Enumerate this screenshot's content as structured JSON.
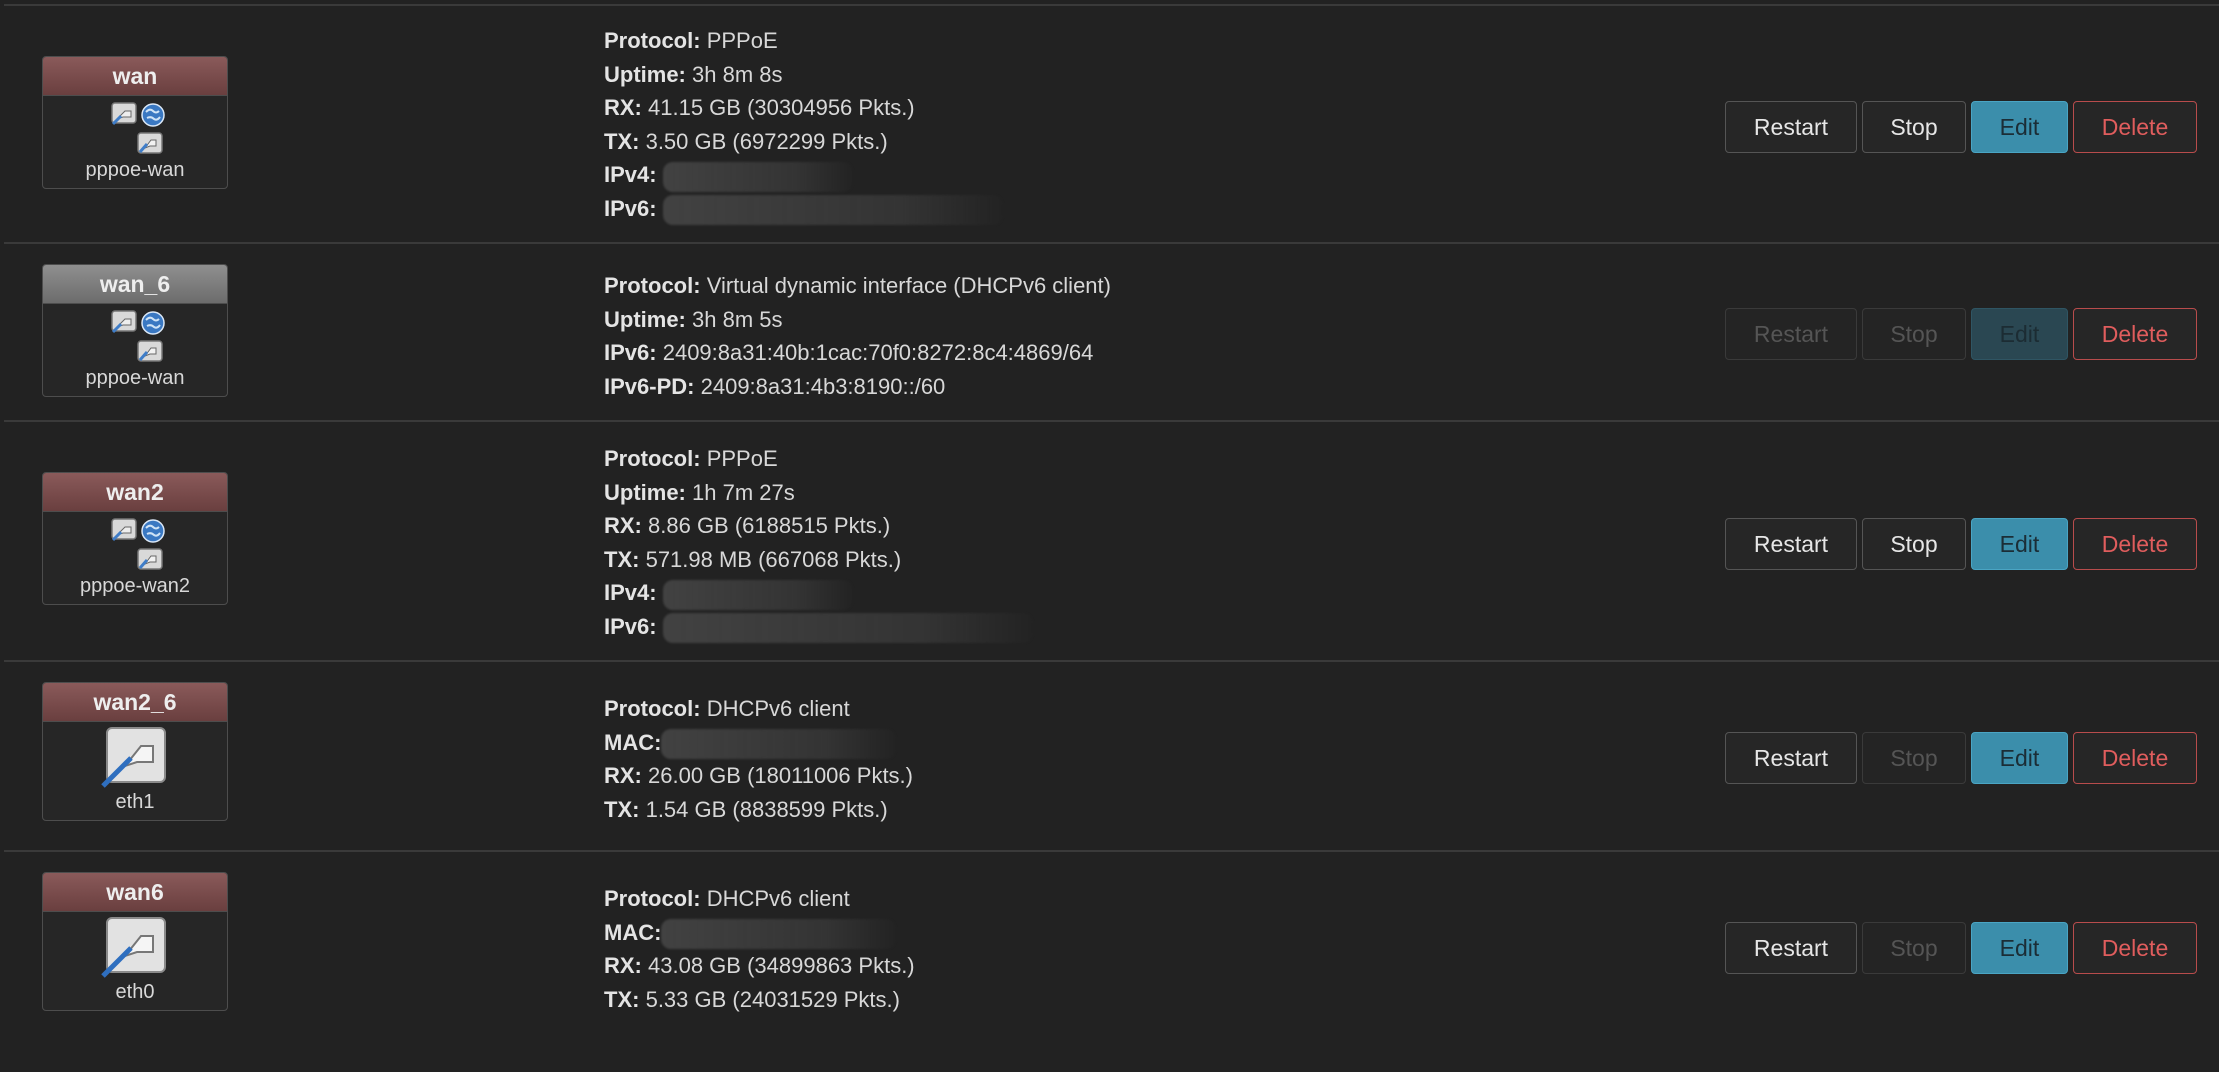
{
  "colors": {
    "background": "#222222",
    "badge_header_active": "#7a4b4b",
    "badge_header_inactive": "#7d7d7d",
    "edit_button": "#3b8eab",
    "delete_text": "#e05d5d"
  },
  "interfaces": [
    {
      "name": "wan",
      "device": "pppoe-wan",
      "icons": [
        "pppoe-device-icon",
        "globe-icon",
        "ethernet-port-icon"
      ],
      "details": [
        {
          "key": "Protocol:",
          "value": "PPPoE"
        },
        {
          "key": "Uptime:",
          "value": "3h 8m 8s"
        },
        {
          "key": "RX:",
          "value": "41.15 GB (30304956 Pkts.)"
        },
        {
          "key": "TX:",
          "value": "3.50 GB (6972299 Pkts.)"
        },
        {
          "key": "IPv4:",
          "value": ""
        },
        {
          "key": "IPv6:",
          "value": ""
        }
      ],
      "buttons": {
        "restart": "Restart",
        "stop": "Stop",
        "edit": "Edit",
        "delete": "Delete"
      }
    },
    {
      "name": "wan_6",
      "device": "pppoe-wan",
      "icons": [
        "pppoe-device-icon",
        "globe-icon",
        "ethernet-port-icon"
      ],
      "details": [
        {
          "key": "Protocol:",
          "value": "Virtual dynamic interface (DHCPv6 client)"
        },
        {
          "key": "Uptime:",
          "value": "3h 8m 5s"
        },
        {
          "key": "IPv6:",
          "value": "2409:8a31:40b:1cac:70f0:8272:8c4:4869/64"
        },
        {
          "key": "IPv6-PD:",
          "value": "2409:8a31:4b3:8190::/60"
        }
      ],
      "buttons": {
        "restart": "Restart",
        "stop": "Stop",
        "edit": "Edit",
        "delete": "Delete"
      }
    },
    {
      "name": "wan2",
      "device": "pppoe-wan2",
      "icons": [
        "pppoe-device-icon",
        "globe-icon",
        "ethernet-port-icon"
      ],
      "details": [
        {
          "key": "Protocol:",
          "value": "PPPoE"
        },
        {
          "key": "Uptime:",
          "value": "1h 7m 27s"
        },
        {
          "key": "RX:",
          "value": "8.86 GB (6188515 Pkts.)"
        },
        {
          "key": "TX:",
          "value": "571.98 MB (667068 Pkts.)"
        },
        {
          "key": "IPv4:",
          "value": ""
        },
        {
          "key": "IPv6:",
          "value": ""
        }
      ],
      "buttons": {
        "restart": "Restart",
        "stop": "Stop",
        "edit": "Edit",
        "delete": "Delete"
      }
    },
    {
      "name": "wan2_6",
      "device": "eth1",
      "icons": [
        "ethernet-port-icon"
      ],
      "details": [
        {
          "key": "Protocol:",
          "value": "DHCPv6 client"
        },
        {
          "key": "MAC:",
          "value": ""
        },
        {
          "key": "RX:",
          "value": "26.00 GB (18011006 Pkts.)"
        },
        {
          "key": "TX:",
          "value": "1.54 GB (8838599 Pkts.)"
        }
      ],
      "buttons": {
        "restart": "Restart",
        "stop": "Stop",
        "edit": "Edit",
        "delete": "Delete"
      }
    },
    {
      "name": "wan6",
      "device": "eth0",
      "icons": [
        "ethernet-port-icon"
      ],
      "details": [
        {
          "key": "Protocol:",
          "value": "DHCPv6 client"
        },
        {
          "key": "MAC:",
          "value": ""
        },
        {
          "key": "RX:",
          "value": "43.08 GB (34899863 Pkts.)"
        },
        {
          "key": "TX:",
          "value": "5.33 GB (24031529 Pkts.)"
        }
      ],
      "buttons": {
        "restart": "Restart",
        "stop": "Stop",
        "edit": "Edit",
        "delete": "Delete"
      }
    }
  ]
}
